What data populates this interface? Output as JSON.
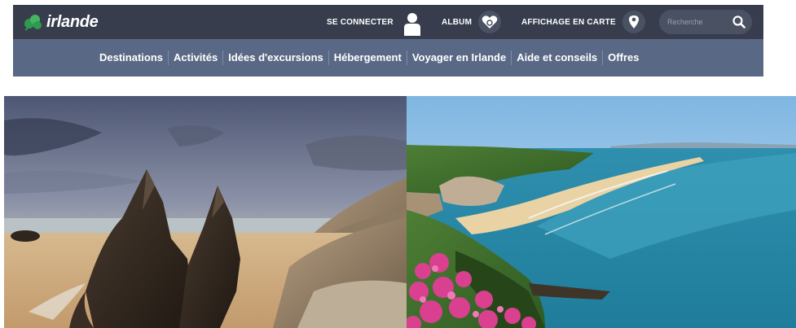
{
  "site": {
    "brand": "irlande"
  },
  "topbar": {
    "login_label": "SE CONNECTER",
    "album_label": "ALBUM",
    "map_label": "AFFICHAGE EN CARTE",
    "search_placeholder": "Recherche"
  },
  "nav": {
    "items": [
      {
        "label": "Destinations"
      },
      {
        "label": "Activités"
      },
      {
        "label": "Idées d'excursions"
      },
      {
        "label": "Hébergement"
      },
      {
        "label": "Voyager en Irlande"
      },
      {
        "label": "Aide et conseils"
      },
      {
        "label": "Offres"
      }
    ]
  },
  "colors": {
    "topbar": "#373d4d",
    "navbar": "#596985",
    "brand_green": "#2e9a4e"
  },
  "icons": {
    "logo": "shamrock-icon",
    "login": "user-icon",
    "album": "heart-icon",
    "map": "map-pin-icon",
    "search": "search-icon"
  },
  "hero": {
    "left_image": "sea-stacks-beach-image",
    "right_image": "coastal-cliffs-image"
  }
}
